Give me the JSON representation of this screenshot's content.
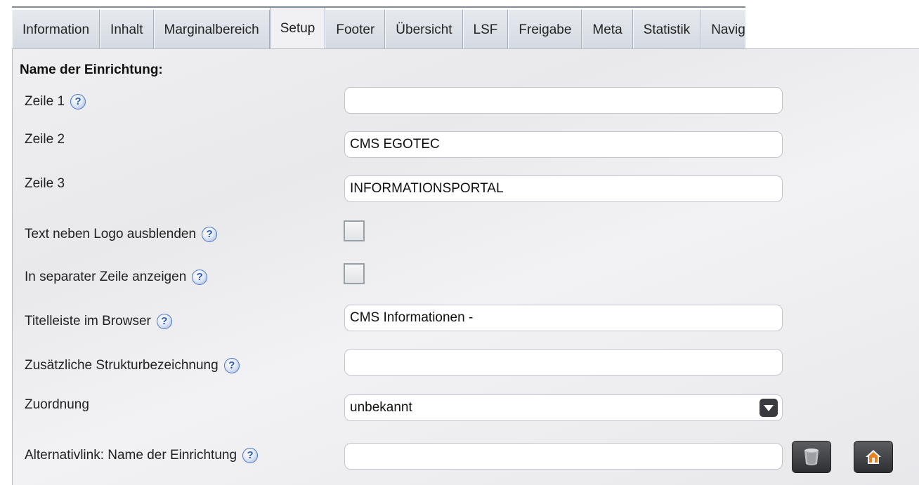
{
  "tabs": [
    {
      "label": "Information"
    },
    {
      "label": "Inhalt"
    },
    {
      "label": "Marginalbereich"
    },
    {
      "label": "Setup",
      "active": true
    },
    {
      "label": "Footer"
    },
    {
      "label": "Übersicht"
    },
    {
      "label": "LSF"
    },
    {
      "label": "Freigabe"
    },
    {
      "label": "Meta"
    },
    {
      "label": "Statistik"
    },
    {
      "label": "Navig"
    }
  ],
  "form": {
    "section_title": "Name der Einrichtung:",
    "zeile1": {
      "label": "Zeile 1",
      "value": ""
    },
    "zeile2": {
      "label": "Zeile 2",
      "value": "CMS EGOTEC"
    },
    "zeile3": {
      "label": "Zeile 3",
      "value": "INFORMATIONSPORTAL"
    },
    "hide_text": {
      "label": "Text neben Logo ausblenden",
      "checked": false
    },
    "separate_line": {
      "label": "In separater Zeile anzeigen",
      "checked": false
    },
    "browser_title": {
      "label": "Titelleiste im Browser",
      "value": "CMS Informationen -"
    },
    "structure": {
      "label": "Zusätzliche Strukturbezeichnung",
      "value": ""
    },
    "assignment": {
      "label": "Zuordnung",
      "value": "unbekannt"
    },
    "altlink": {
      "label": "Alternativlink: Name der Einrichtung",
      "value": ""
    }
  },
  "help_symbol": "?",
  "icons": {
    "help": "question-circle-icon",
    "dropdown": "chevron-down-icon",
    "delete": "trash-icon",
    "home": "home-icon"
  },
  "colors": {
    "help_blue": "#2e5db5",
    "home_orange": "#e8821e"
  }
}
